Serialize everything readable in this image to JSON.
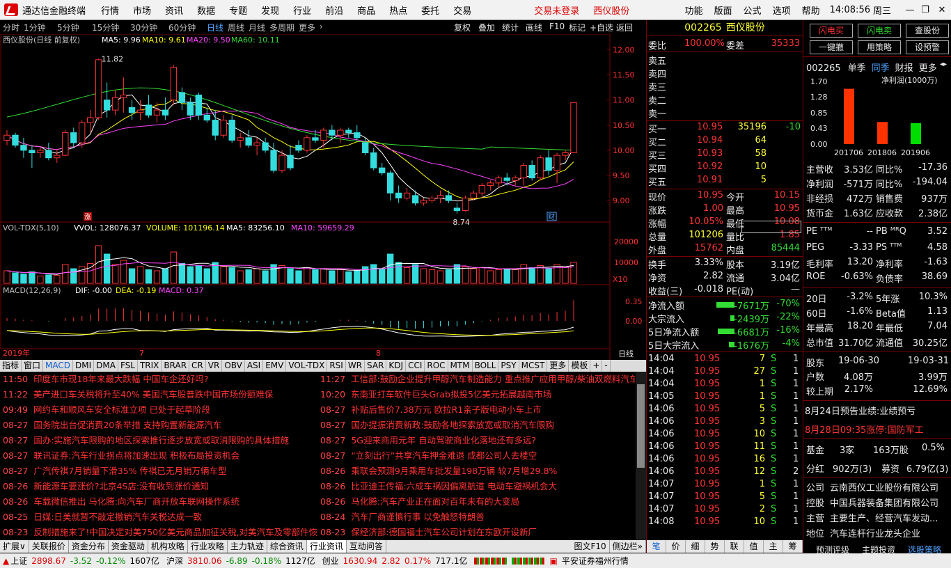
{
  "window": {
    "title": "通达信金融终端",
    "menu": [
      "行情",
      "市场",
      "资讯",
      "数据",
      "专题",
      "发现",
      "行业",
      "前沿",
      "商品",
      "热点",
      "委托",
      "交易"
    ],
    "login": "交易未登录",
    "stock_short": "西仪股份",
    "right_menu": [
      "功能",
      "版面",
      "公式",
      "选项",
      "帮助"
    ],
    "time": "14:08:56",
    "weekday": "周三"
  },
  "toolbar": {
    "periods": [
      "分时",
      "1分钟",
      "5分钟",
      "15分钟",
      "30分钟",
      "60分钟",
      "日线",
      "周线",
      "月线",
      "多周期",
      "更多"
    ],
    "selected": "日线",
    "right": [
      "复权",
      "叠加",
      "统计",
      "画线",
      "F10",
      "标记",
      "+自选",
      "返回"
    ]
  },
  "chart_header": {
    "name": "西仪股份(日线 前复权)",
    "ma5": "MA5: 9.96",
    "ma10": "MA10: 9.61",
    "ma20": "MA20: 9.50",
    "ma60": "MA60: 10.11",
    "high_mark": "11.82",
    "low_mark": "8.74",
    "zhang": "涨",
    "cai": "财"
  },
  "price_axis": [
    "12.00",
    "11.50",
    "11.00",
    "10.50",
    "10.00",
    "9.50",
    "9.00"
  ],
  "vol_header": {
    "name": "VOL-TDX(5,10)",
    "vvol": "VVOL: 128076.37",
    "volume": "VOLUME: 101196.14",
    "ma5": "MA5: 83256.10",
    "ma10": "MA10: 59659.29"
  },
  "vol_axis": [
    "20000",
    "10000"
  ],
  "vol_unit": "X10",
  "macd_header": {
    "name": "MACD(12,26,9)",
    "dif": "DIF: -0.00",
    "dea": "DEA: -0.19",
    "macd": "MACD: 0.37"
  },
  "macd_axis": [
    "0.35",
    "0.00"
  ],
  "date_axis": {
    "year": "2019年",
    "m7": "7",
    "m8": "8",
    "period": "日线"
  },
  "indicator_tabs": [
    "指标",
    "窗口",
    "MACD",
    "DMI",
    "DMA",
    "FSL",
    "TRIX",
    "BRAR",
    "CR",
    "VR",
    "OBV",
    "ASI",
    "EMV",
    "VOL-TDX",
    "RSI",
    "WR",
    "SAR",
    "KDJ",
    "CCI",
    "ROC",
    "MTM",
    "BOLL",
    "PSY",
    "MCST",
    "更多",
    "模板",
    "+",
    "-"
  ],
  "chart_data": {
    "type": "candlestick",
    "ylim": [
      8.6,
      12.2
    ],
    "ohlc": [
      [
        10.2,
        10.4,
        10.1,
        10.3
      ],
      [
        10.3,
        10.35,
        10.05,
        10.1
      ],
      [
        10.1,
        10.25,
        9.85,
        10.0
      ],
      [
        10.0,
        10.1,
        9.65,
        9.95
      ],
      [
        9.95,
        10.05,
        9.85,
        10.0
      ],
      [
        10.0,
        10.15,
        9.8,
        9.85
      ],
      [
        9.85,
        10.0,
        9.75,
        9.9
      ],
      [
        9.9,
        10.4,
        9.88,
        10.35
      ],
      [
        10.35,
        10.45,
        10.05,
        10.15
      ],
      [
        10.15,
        10.6,
        10.05,
        10.55
      ],
      [
        10.55,
        10.8,
        10.35,
        10.65
      ],
      [
        10.65,
        11.82,
        10.6,
        11.8
      ],
      [
        11.0,
        11.35,
        10.65,
        10.8
      ],
      [
        10.8,
        11.2,
        10.7,
        11.05
      ],
      [
        11.05,
        11.45,
        10.75,
        11.1
      ],
      [
        10.85,
        11.0,
        10.6,
        10.75
      ],
      [
        10.75,
        11.0,
        10.6,
        10.8
      ],
      [
        10.9,
        11.1,
        10.65,
        10.7
      ],
      [
        10.7,
        10.95,
        10.55,
        10.8
      ],
      [
        10.8,
        11.05,
        10.6,
        10.7
      ],
      [
        11.0,
        11.7,
        10.9,
        11.65
      ],
      [
        11.15,
        11.25,
        10.8,
        10.95
      ],
      [
        10.95,
        11.05,
        10.6,
        10.7
      ],
      [
        11.1,
        11.15,
        10.6,
        10.7
      ],
      [
        10.7,
        10.85,
        10.55,
        10.6
      ],
      [
        10.6,
        10.8,
        10.2,
        10.3
      ],
      [
        10.3,
        10.7,
        10.25,
        10.6
      ],
      [
        10.6,
        10.7,
        10.15,
        10.2
      ],
      [
        10.2,
        10.35,
        10.05,
        10.25
      ],
      [
        10.25,
        10.4,
        10.05,
        10.1
      ],
      [
        10.1,
        10.25,
        9.9,
        10.15
      ],
      [
        10.15,
        10.25,
        9.95,
        10.0
      ],
      [
        10.0,
        10.15,
        9.55,
        9.6
      ],
      [
        9.6,
        10.0,
        9.55,
        9.9
      ],
      [
        9.9,
        10.1,
        9.6,
        9.65
      ],
      [
        10.1,
        10.2,
        9.95,
        10.0
      ],
      [
        10.0,
        10.3,
        9.95,
        10.25
      ],
      [
        10.25,
        10.4,
        10.15,
        10.2
      ],
      [
        10.2,
        10.45,
        10.05,
        10.4
      ],
      [
        10.4,
        10.5,
        10.2,
        10.3
      ],
      [
        10.3,
        10.45,
        10.15,
        10.4
      ],
      [
        10.4,
        10.45,
        10.25,
        10.35
      ],
      [
        10.35,
        10.5,
        10.2,
        10.25
      ],
      [
        10.15,
        10.25,
        9.9,
        9.95
      ],
      [
        9.95,
        10.05,
        9.6,
        9.65
      ],
      [
        9.65,
        9.75,
        9.5,
        9.55
      ],
      [
        9.55,
        9.6,
        9.0,
        9.15
      ],
      [
        9.15,
        9.3,
        8.95,
        9.05
      ],
      [
        9.05,
        9.25,
        9.0,
        9.15
      ],
      [
        9.1,
        9.2,
        8.9,
        8.95
      ],
      [
        8.95,
        9.05,
        8.9,
        9.0
      ],
      [
        9.0,
        9.1,
        8.95,
        9.05
      ],
      [
        9.05,
        9.2,
        8.95,
        9.1
      ],
      [
        9.1,
        9.2,
        8.95,
        9.0
      ],
      [
        8.85,
        8.95,
        8.74,
        8.8
      ],
      [
        8.8,
        9.1,
        8.78,
        9.05
      ],
      [
        9.05,
        9.2,
        9.0,
        9.15
      ],
      [
        9.15,
        9.35,
        9.05,
        9.3
      ],
      [
        9.3,
        9.4,
        9.2,
        9.35
      ],
      [
        9.35,
        9.5,
        9.25,
        9.45
      ],
      [
        9.45,
        9.55,
        9.3,
        9.4
      ],
      [
        9.4,
        9.5,
        9.3,
        9.45
      ],
      [
        9.45,
        9.75,
        9.3,
        9.7
      ],
      [
        9.7,
        9.8,
        9.4,
        9.45
      ],
      [
        9.45,
        9.9,
        9.4,
        9.85
      ],
      [
        9.85,
        10.0,
        9.5,
        9.6
      ],
      [
        9.6,
        9.95,
        9.35,
        9.9
      ],
      [
        9.9,
        10.0,
        9.8,
        9.95
      ],
      [
        9.95,
        10.95,
        9.95,
        10.95
      ]
    ],
    "volume": [
      6000,
      5000,
      4500,
      5500,
      3500,
      4000,
      3800,
      9000,
      7000,
      8000,
      9500,
      18000,
      14000,
      9000,
      11000,
      7000,
      8000,
      6500,
      6000,
      7000,
      15000,
      9500,
      8000,
      8500,
      7000,
      10000,
      8000,
      7500,
      6000,
      6500,
      7000,
      6000,
      9000,
      8500,
      7000,
      6000,
      7500,
      6500,
      7000,
      6000,
      6500,
      5500,
      6000,
      8000,
      9000,
      7000,
      14000,
      10000,
      7500,
      9000,
      7000,
      6500,
      6000,
      6500,
      9000,
      8000,
      7000,
      7500,
      6000,
      6500,
      7000,
      6500,
      9000,
      7500,
      8500,
      7000,
      9000,
      8000,
      10120
    ],
    "macd": [
      0.05,
      0.04,
      0.02,
      0.01,
      0.0,
      -0.01,
      0.0,
      0.05,
      0.06,
      0.09,
      0.12,
      0.22,
      0.22,
      0.22,
      0.23,
      0.2,
      0.18,
      0.15,
      0.13,
      0.11,
      0.17,
      0.15,
      0.12,
      0.1,
      0.07,
      0.03,
      0.02,
      -0.01,
      -0.02,
      -0.03,
      -0.03,
      -0.04,
      -0.07,
      -0.06,
      -0.07,
      -0.06,
      -0.03,
      -0.02,
      0.0,
      0.0,
      0.02,
      0.02,
      0.01,
      -0.02,
      -0.05,
      -0.07,
      -0.12,
      -0.14,
      -0.13,
      -0.14,
      -0.13,
      -0.12,
      -0.1,
      -0.09,
      -0.1,
      -0.07,
      -0.04,
      -0.01,
      0.02,
      0.05,
      0.06,
      0.08,
      0.11,
      0.1,
      0.14,
      0.12,
      0.16,
      0.18,
      0.37
    ],
    "ma_series": [
      "MA5",
      "MA10",
      "MA20",
      "MA60"
    ]
  },
  "quote": {
    "code": "002265",
    "name": "西仪股份",
    "weibi_label": "委比",
    "weibi": "100.00%",
    "weicha_label": "委差",
    "weicha": "35333",
    "sells": [
      "卖五",
      "卖四",
      "卖三",
      "卖二",
      "卖一"
    ],
    "buys": [
      {
        "l": "买一",
        "p": "10.95",
        "v": "35196",
        "c": "-10"
      },
      {
        "l": "买二",
        "p": "10.94",
        "v": "64",
        "c": ""
      },
      {
        "l": "买三",
        "p": "10.93",
        "v": "58",
        "c": ""
      },
      {
        "l": "买四",
        "p": "10.92",
        "v": "10",
        "c": ""
      },
      {
        "l": "买五",
        "p": "10.91",
        "v": "5",
        "c": ""
      }
    ],
    "stats": [
      [
        "现价",
        "10.95",
        "今开",
        "10.15"
      ],
      [
        "涨跌",
        "1.00",
        "最高",
        "10.95"
      ],
      [
        "涨幅",
        "10.05%",
        "最低",
        "10.08"
      ],
      [
        "总量",
        "101206",
        "量比",
        "1.85"
      ],
      [
        "外盘",
        "15762",
        "内盘",
        "85444"
      ]
    ],
    "stats2": [
      [
        "换手",
        "3.33%",
        "股本",
        "3.19亿"
      ],
      [
        "净资",
        "2.82",
        "流通",
        "3.04亿"
      ],
      [
        "收益(三)",
        "-0.018",
        "PE(动)",
        "—"
      ]
    ],
    "flows": [
      [
        "净流入额",
        "-7671万",
        "-70%"
      ],
      [
        "大宗流入",
        "-2439万",
        "-22%"
      ],
      [
        "5日净流入额",
        "-6681万",
        "-16%"
      ],
      [
        "5日大宗流入",
        "-1676万",
        "-4%"
      ]
    ],
    "ticks": [
      [
        "14:04",
        "10.95",
        "7",
        "S",
        "1"
      ],
      [
        "14:04",
        "10.95",
        "27",
        "S",
        "1"
      ],
      [
        "14:04",
        "10.95",
        "1",
        "S",
        "1"
      ],
      [
        "14:05",
        "10.95",
        "1",
        "S",
        "1"
      ],
      [
        "14:06",
        "10.95",
        "5",
        "S",
        "1"
      ],
      [
        "14:06",
        "10.95",
        "3",
        "S",
        "1"
      ],
      [
        "14:06",
        "10.95",
        "10",
        "S",
        "1"
      ],
      [
        "14:06",
        "10.95",
        "11",
        "S",
        "1"
      ],
      [
        "14:06",
        "10.95",
        "16",
        "S",
        "1"
      ],
      [
        "14:06",
        "10.95",
        "12",
        "S",
        "2"
      ],
      [
        "14:07",
        "10.95",
        "1",
        "S",
        "1"
      ],
      [
        "14:07",
        "10.95",
        "5",
        "S",
        "1"
      ],
      [
        "14:07",
        "10.95",
        "2",
        "S",
        "1"
      ],
      [
        "14:08",
        "10.95",
        "10",
        "S",
        "1"
      ]
    ],
    "tabs": [
      "笔",
      "价",
      "细",
      "势",
      "联",
      "值",
      "主",
      "筹"
    ]
  },
  "fin": {
    "buttons": [
      "闪电买",
      "闪电卖",
      "查股份",
      "一键撤",
      "用策略",
      "设预警"
    ],
    "code": "002265",
    "tabs": [
      "单季",
      "同季",
      "财报",
      "更多"
    ],
    "tab_selected": "同季",
    "chart_title": "净利润(1000万)",
    "bars": [
      {
        "label": "201706",
        "value": 1.5,
        "color": "#ff3300"
      },
      {
        "label": "201806",
        "value": 0.6,
        "color": "#ff3300"
      },
      {
        "label": "201906",
        "value": -0.57,
        "color": "#00dd00"
      }
    ],
    "yaxis": [
      "1.70",
      "1.28",
      "0.85",
      "0.43",
      "0.00"
    ],
    "rows": [
      [
        "主营收",
        "3.53亿",
        "同比%",
        "-17.36"
      ],
      [
        "净利润",
        "-571万",
        "同比%",
        "-194.04"
      ],
      [
        "非经损",
        "472万",
        "销售费",
        "937万"
      ],
      [
        "货币金",
        "1.63亿",
        "应收款",
        "2.38亿"
      ],
      [
        "PE ᵀᵀᴹ",
        "--",
        "PB ᴹᴿQ",
        "3.52"
      ],
      [
        "PEG",
        "-3.33",
        "PS ᵀᵀᴹ",
        "4.58"
      ],
      [
        "毛利率",
        "13.20",
        "净利率",
        "-1.63"
      ],
      [
        "ROE",
        "-0.63%",
        "负债率",
        "38.69"
      ],
      [
        "20日",
        "-3.2%",
        "5年涨",
        "10.3%"
      ],
      [
        "60日",
        "-1.6%",
        "Beta值",
        "1.13"
      ],
      [
        "年最高",
        "18.20",
        "年最低",
        "7.04"
      ],
      [
        "总市值",
        "31.70亿",
        "流通值",
        "30.25亿"
      ],
      [
        "股东",
        "19-06-30",
        "",
        "19-03-31"
      ],
      [
        "户数",
        "4.08万",
        "",
        "3.99万"
      ],
      [
        "较上期",
        "2.17%",
        "",
        "12.69%"
      ]
    ],
    "notice1": "8月24日预告业绩:业绩预亏",
    "notice2": "8月28日09:35涨停:国防军工",
    "fund": [
      "基金",
      "3家",
      "163万股",
      "0.5%"
    ],
    "bonus": [
      "分红",
      "902万(3)",
      "募资",
      "6.79亿(3)"
    ],
    "company": [
      [
        "公司",
        "云南西仪工业股份有限公司"
      ],
      [
        "控股",
        "中国兵器装备集团有限公司"
      ],
      [
        "主营",
        "主要生产、经营汽车发动..."
      ],
      [
        "地位",
        "汽车连杆行业龙头企业"
      ]
    ],
    "bottom": [
      "预测评级",
      "主题投资",
      "选股策略"
    ]
  },
  "news": {
    "left": [
      [
        "11:50",
        "印度车市现18年来最大跌幅 中国车企还好吗?"
      ],
      [
        "11:22",
        "美产进口车关税将升至40% 美国汽车股普跌中国市场份额难保"
      ],
      [
        "09:49",
        "网约车和顺风车安全标准立项 已处于起草阶段"
      ],
      [
        "08-27",
        "国务院出台促消费20条举措 支持购置新能源汽车"
      ],
      [
        "08-27",
        "国办:实施汽车限购的地区探索推行逐步放宽或取消限购的具体措施"
      ],
      [
        "08-27",
        "联讯证券:汽车行业拐点将加速出现 积极布局投资机会"
      ],
      [
        "08-27",
        "广汽传祺7月销量下滑35% 传祺已无月销万辆车型"
      ],
      [
        "08-26",
        "新能源车要涨价?北京4S店:没有收到涨价通知"
      ],
      [
        "08-26",
        "车载微信推出 马化腾:向汽车厂商开放车联网操作系统"
      ],
      [
        "08-25",
        "日媒:日美就暂不敲定撤销汽车关税达成一致"
      ],
      [
        "08-23",
        "反制措施来了!中国决定对美750亿美元商品加征关税,对美汽车及零部件恢复加征关税"
      ]
    ],
    "right": [
      [
        "11:27",
        "工信部:鼓励企业提升甲醇汽车制造能力 重点推广应用甲醇/柴油双燃料汽车"
      ],
      [
        "10:20",
        "东南亚打车软件巨头Grab拟投5亿美元拓展越南市场"
      ],
      [
        "08-27",
        "补贴后售价7.38万元 欧拉R1亲子版电动小车上市"
      ],
      [
        "08-27",
        "国办提振消费新政:鼓励各地探索放宽或取消汽车限购"
      ],
      [
        "08-27",
        "5G迎来商用元年 自动驾驶商业化落地还有多远?"
      ],
      [
        "08-27",
        "“立刻出行”共享汽车押金难退 成都公司人去楼空"
      ],
      [
        "08-26",
        "乘联会预测9月乘用车批发量198万辆 较7月增29.8%"
      ],
      [
        "08-26",
        "比亚迪王传福:六成车祸因偏离航道 电动车避祸机会大"
      ],
      [
        "08-26",
        "马化腾:汽车产业正在面对百年未有的大变局"
      ],
      [
        "08-24",
        "汽车厂商谨慎行事 以免触怒特朗普"
      ],
      [
        "08-23",
        "保经济部:德国福士汽车公司计划在东欧开设新厂"
      ]
    ]
  },
  "bottom_tabs": [
    "扩展∨",
    "关联报价",
    "资金分布",
    "资金驱动",
    "机构攻略",
    "行业攻略",
    "主力轨迹",
    "综合资讯",
    "行业资讯",
    "互动问答"
  ],
  "bottom_tabs_right": [
    "图文F10",
    "侧边栏»"
  ],
  "status": {
    "sh": "上证",
    "sh_v": "2898.67",
    "sh_c": "-3.52",
    "sh_p": "-0.12%",
    "sh_a": "1607亿",
    "sz": "沪深",
    "sz_v": "3810.06",
    "sz_c": "-6.89",
    "sz_p": "-0.18%",
    "sz_a": "1127亿",
    "cy": "创业",
    "cy_v": "1630.94",
    "cy_c": "2.82",
    "cy_p": "0.17%",
    "cy_a": "717.1亿",
    "broker": "平安证券福州行情"
  }
}
